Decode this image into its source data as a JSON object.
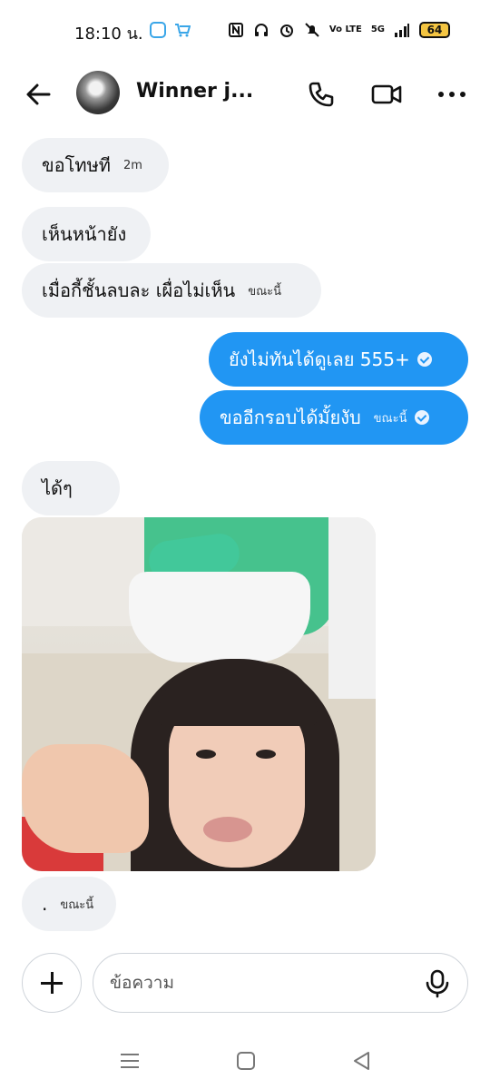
{
  "status_bar": {
    "time": "18:10 น.",
    "battery": "64",
    "network": "5G",
    "volte": "Vo LTE"
  },
  "header": {
    "contact_name": "Winner j...",
    "icons": [
      "back-arrow-icon",
      "phone-icon",
      "video-camera-icon",
      "more-dots-icon"
    ]
  },
  "messages": [
    {
      "direction": "incoming",
      "text": "ขอโทษที",
      "time": "2m"
    },
    {
      "direction": "incoming",
      "text": "เห็นหน้ายัง",
      "time": ""
    },
    {
      "direction": "incoming",
      "text": "เมื่อกี้ชั้นลบละ เผื่อไม่เห็น",
      "time": "ขณะนี้"
    },
    {
      "direction": "outgoing",
      "text": "ยังไม่ทันได้ดูเลย 555+",
      "time": ""
    },
    {
      "direction": "outgoing",
      "text": "ขออีกรอบได้มั้ยงับ",
      "time": "ขณะนี้"
    },
    {
      "direction": "incoming",
      "text": "ได้ๆ",
      "time": ""
    },
    {
      "direction": "incoming",
      "type": "photo",
      "description": ""
    },
    {
      "direction": "incoming",
      "text": ".",
      "time": "ขณะนี้"
    }
  ],
  "composer": {
    "placeholder": "ข้อความ",
    "value": ""
  },
  "colors": {
    "outgoing_bubble": "#2196f3",
    "incoming_bubble": "#eff1f4",
    "battery_fill": "#f4c542"
  }
}
